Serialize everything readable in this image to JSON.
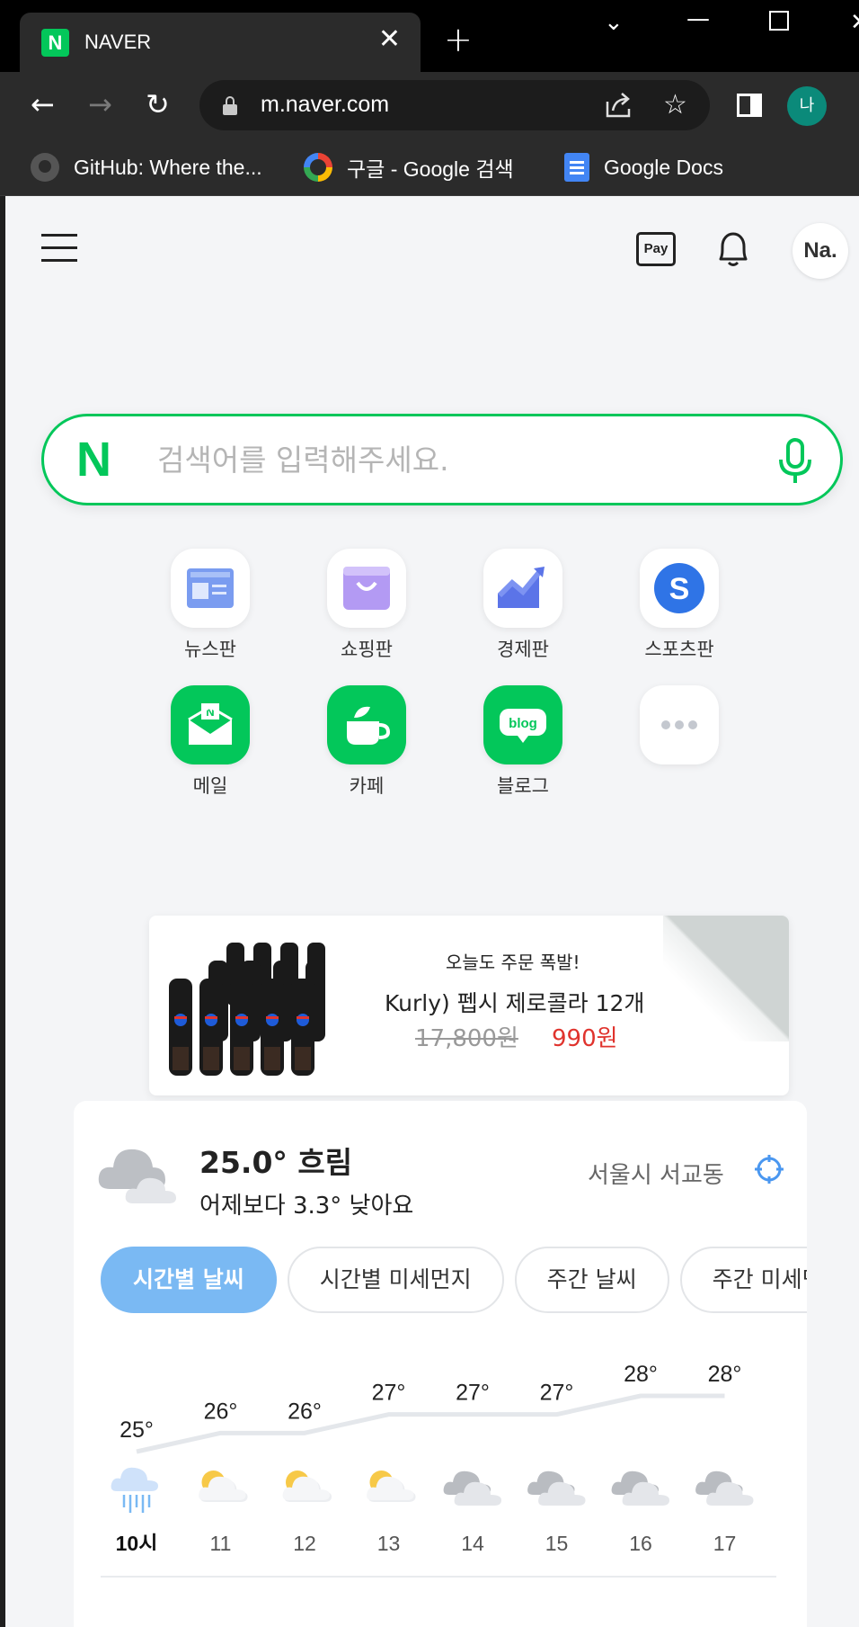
{
  "browser": {
    "tab": {
      "favicon_letter": "N",
      "title": "NAVER"
    },
    "url": "m.naver.com",
    "profile_initial": "나",
    "bookmarks": [
      {
        "label": "GitHub: Where the...",
        "icon": "github-icon"
      },
      {
        "label": "구글 - Google 검색",
        "icon": "google-icon"
      },
      {
        "label": "Google Docs",
        "icon": "docs-icon"
      }
    ]
  },
  "header": {
    "pay_label": "Pay",
    "avatar_text": "Na."
  },
  "search": {
    "logo": "N",
    "placeholder": "검색어를 입력해주세요.",
    "value": ""
  },
  "shortcuts": [
    {
      "label": "뉴스판",
      "icon": "news-icon"
    },
    {
      "label": "쇼핑판",
      "icon": "shopping-bag-icon"
    },
    {
      "label": "경제판",
      "icon": "chart-up-icon"
    },
    {
      "label": "스포츠판",
      "icon": "sports-icon"
    },
    {
      "label": "메일",
      "icon": "mail-icon"
    },
    {
      "label": "카페",
      "icon": "cafe-cup-icon"
    },
    {
      "label": "블로그",
      "icon": "blog-icon"
    },
    {
      "label": "",
      "icon": "more-icon"
    }
  ],
  "shortcut_badges": {
    "news_mail_letter": "N",
    "blog_text": "blog",
    "sports_letter": "S"
  },
  "ad": {
    "tagline": "오늘도 주문 폭발!",
    "title": "Kurly) 펩시 제로콜라 12개",
    "original_price": "17,800원",
    "sale_price": "990원"
  },
  "weather": {
    "current": "25.0° 흐림",
    "comparison": "어제보다 3.3° 낮아요",
    "location": "서울시 서교동",
    "tabs": [
      "시간별 날씨",
      "시간별 미세먼지",
      "주간 날씨",
      "주간 미세먼지"
    ],
    "active_tab": 0
  },
  "chart_data": {
    "type": "line",
    "x": [
      "10시",
      "11",
      "12",
      "13",
      "14",
      "15",
      "16",
      "17"
    ],
    "series": [
      {
        "values": [
          25,
          26,
          26,
          27,
          27,
          27,
          28,
          28
        ]
      }
    ],
    "value_labels": [
      "25°",
      "26°",
      "26°",
      "27°",
      "27°",
      "27°",
      "28°",
      "28°"
    ],
    "icons": [
      "rain-icon",
      "partly-cloudy-icon",
      "partly-cloudy-icon",
      "partly-cloudy-icon",
      "cloudy-icon",
      "cloudy-icon",
      "cloudy-icon",
      "cloudy-icon"
    ],
    "ylim": [
      25,
      28
    ]
  }
}
